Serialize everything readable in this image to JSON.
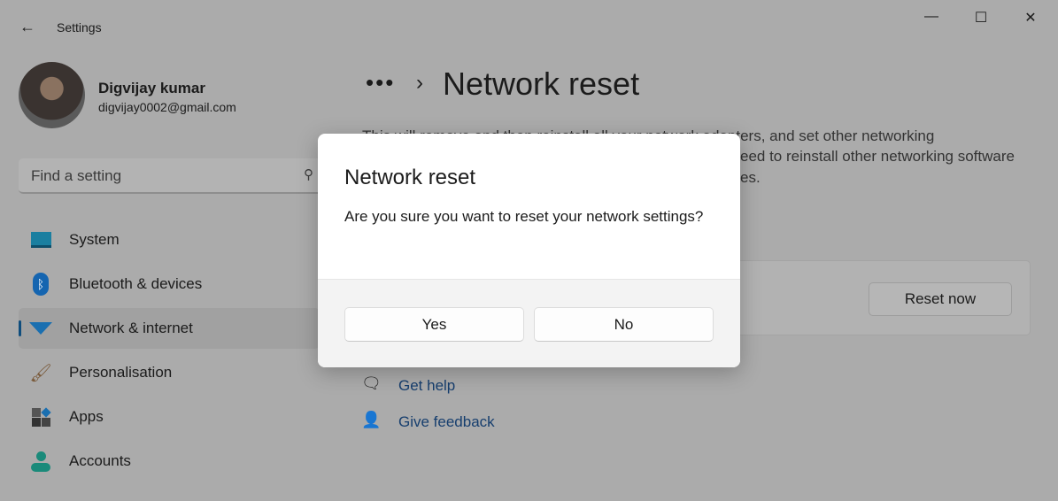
{
  "window": {
    "title": "Settings"
  },
  "user": {
    "name": "Digvijay kumar",
    "email": "digvijay0002@gmail.com"
  },
  "search": {
    "placeholder": "Find a setting"
  },
  "nav": [
    {
      "label": "System",
      "icon": "monitor-icon"
    },
    {
      "label": "Bluetooth & devices",
      "icon": "bluetooth-icon"
    },
    {
      "label": "Network & internet",
      "icon": "wifi-icon",
      "selected": true
    },
    {
      "label": "Personalisation",
      "icon": "brush-icon"
    },
    {
      "label": "Apps",
      "icon": "apps-icon"
    },
    {
      "label": "Accounts",
      "icon": "person-icon"
    }
  ],
  "breadcrumb": {
    "dots": "•••",
    "title": "Network reset"
  },
  "description": {
    "line1": "This will remove and then reinstall all your network adapters, and set other networking",
    "line2": "eed to reinstall other networking software",
    "line3": "es."
  },
  "card": {
    "button": "Reset now"
  },
  "links": {
    "help": "Get help",
    "feedback": "Give feedback"
  },
  "dialog": {
    "title": "Network reset",
    "message": "Are you sure you want to reset your network settings?",
    "yes": "Yes",
    "no": "No"
  },
  "colors": {
    "accent": "#0f4d7d",
    "overlay": "#ababab"
  }
}
